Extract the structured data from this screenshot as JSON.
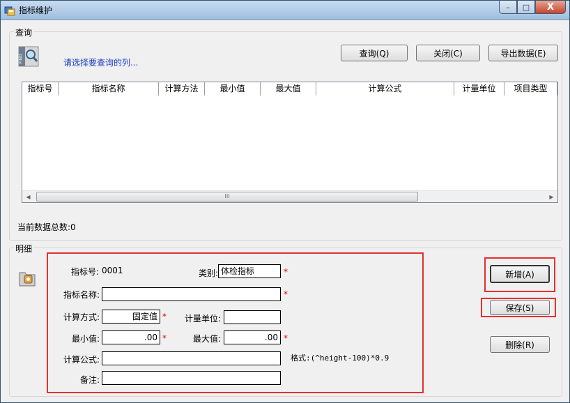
{
  "window": {
    "title": "指标维护",
    "controls": {
      "minimize": "–",
      "maximize": "□",
      "close": "X"
    }
  },
  "query": {
    "legend": "查询",
    "find_icon_text": "FIND",
    "hint": "请选择要查询的列...",
    "buttons": {
      "query": "查询(Q)",
      "close": "关闭(C)",
      "export": "导出数据(E)"
    },
    "grid": {
      "columns": [
        "指标号",
        "指标名称",
        "计算方法",
        "最小值",
        "最大值",
        "计算公式",
        "计量单位",
        "项目类型"
      ],
      "rows": []
    },
    "scrollbar": {
      "left": "◀",
      "right": "▶",
      "grip": "III"
    },
    "count_label": "当前数据总数:",
    "count_value": "0"
  },
  "detail": {
    "legend": "明细",
    "fields": {
      "id": {
        "label": "指标号:",
        "value": "0001"
      },
      "category": {
        "label": "类别:",
        "value": "体检指标"
      },
      "name": {
        "label": "指标名称:",
        "value": ""
      },
      "method": {
        "label": "计算方式:",
        "value": "固定值"
      },
      "unit": {
        "label": "计量单位:",
        "value": ""
      },
      "min": {
        "label": "最小值:",
        "value": ".00"
      },
      "max": {
        "label": "最大值:",
        "value": ".00"
      },
      "formula": {
        "label": "计算公式:",
        "value": ""
      },
      "remark": {
        "label": "备注:",
        "value": ""
      }
    },
    "required_mark": "*",
    "format_hint": "格式:(^height-100)*0.9",
    "buttons": {
      "add": "新增(A)",
      "save": "保存(S)",
      "delete": "删除(R)"
    }
  },
  "colors": {
    "highlight": "#e53030",
    "hint": "#1c3ec4",
    "required": "#e00000"
  }
}
